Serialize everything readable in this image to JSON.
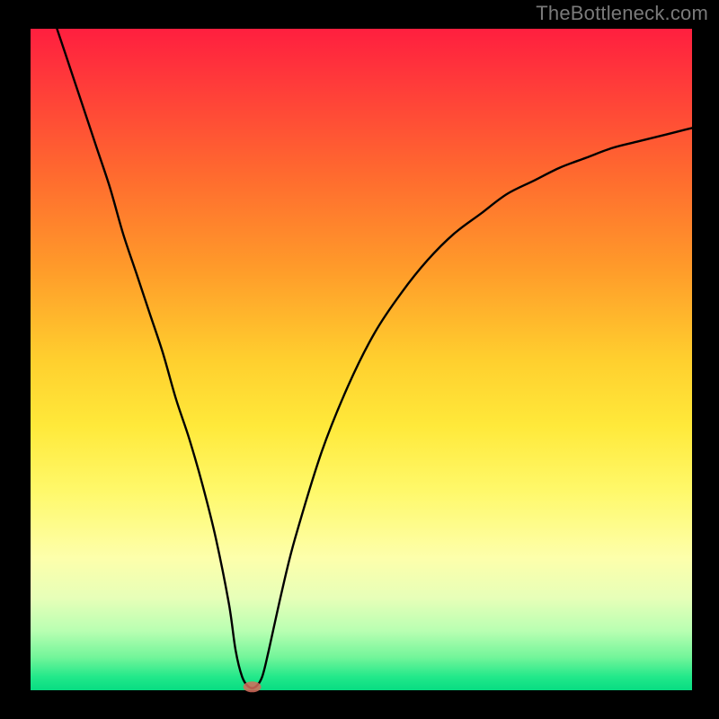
{
  "watermark": "TheBottleneck.com",
  "chart_data": {
    "type": "line",
    "title": "",
    "xlabel": "",
    "ylabel": "",
    "xlim": [
      0,
      100
    ],
    "ylim": [
      0,
      100
    ],
    "series": [
      {
        "name": "bottleneck-curve",
        "x": [
          4,
          6,
          8,
          10,
          12,
          14,
          16,
          18,
          20,
          22,
          24,
          26,
          28,
          30,
          31,
          32,
          33,
          34,
          35,
          36,
          38,
          40,
          44,
          48,
          52,
          56,
          60,
          64,
          68,
          72,
          76,
          80,
          84,
          88,
          92,
          96,
          100
        ],
        "y": [
          100,
          94,
          88,
          82,
          76,
          69,
          63,
          57,
          51,
          44,
          38,
          31,
          23,
          13,
          6,
          2,
          0.5,
          0.5,
          2,
          6,
          15,
          23,
          36,
          46,
          54,
          60,
          65,
          69,
          72,
          75,
          77,
          79,
          80.5,
          82,
          83,
          84,
          85
        ]
      }
    ],
    "annotations": [
      {
        "kind": "vertex-marker",
        "x": 33.5,
        "y": 0.5,
        "color": "#d66a5a"
      }
    ],
    "gradient_background": {
      "orientation": "vertical",
      "stops": [
        {
          "pos": 0.0,
          "color": "#ff1f3f"
        },
        {
          "pos": 0.5,
          "color": "#ffcf2e"
        },
        {
          "pos": 0.8,
          "color": "#fdffab"
        },
        {
          "pos": 1.0,
          "color": "#07dc82"
        }
      ]
    }
  }
}
